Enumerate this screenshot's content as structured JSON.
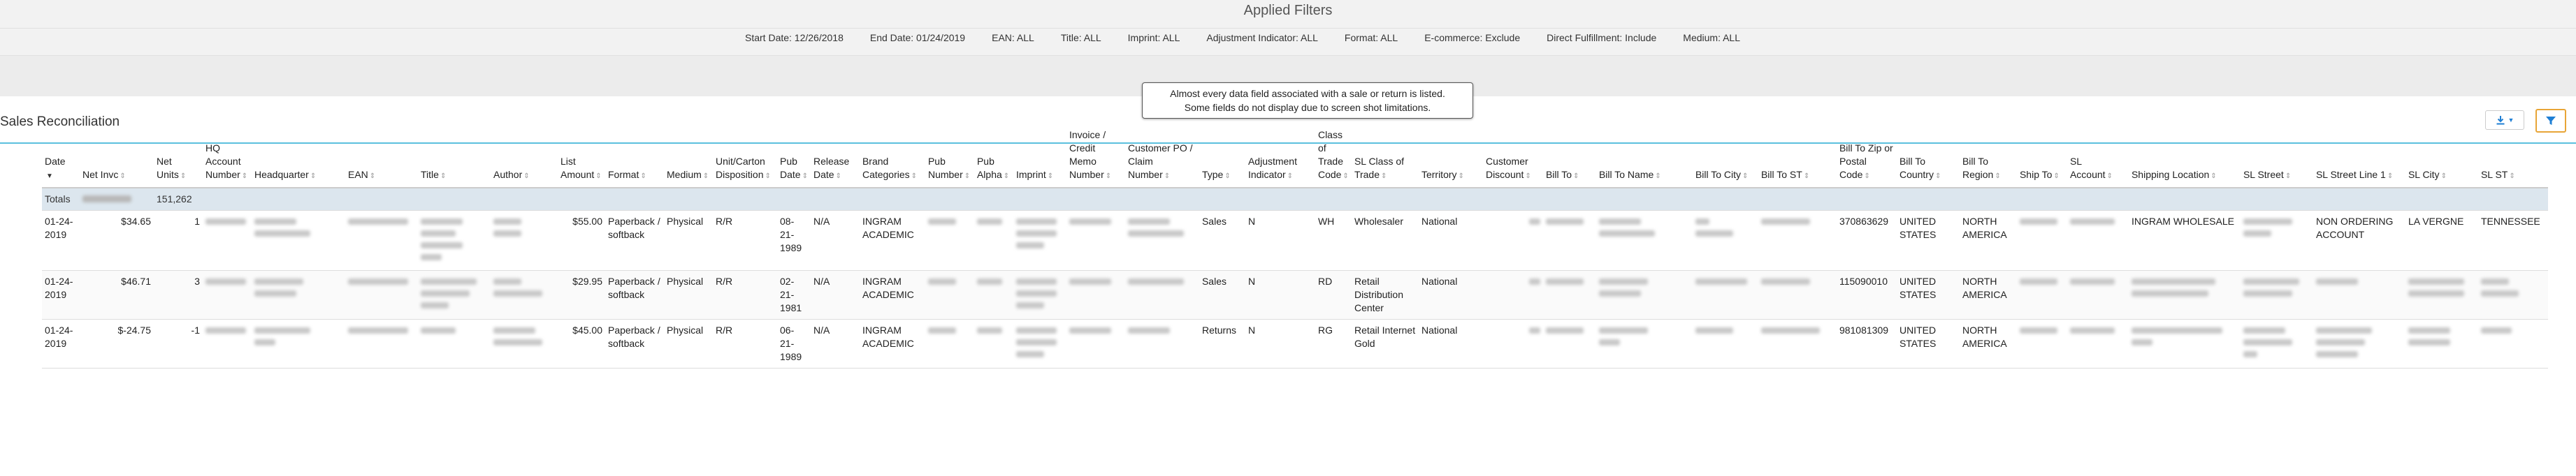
{
  "applied_filters": {
    "title": "Applied Filters",
    "items": [
      "Start Date: 12/26/2018",
      "End Date: 01/24/2019",
      "EAN: ALL",
      "Title: ALL",
      "Imprint: ALL",
      "Adjustment Indicator: ALL",
      "Format: ALL",
      "E-commerce: Exclude",
      "Direct Fulfillment: Include",
      "Medium: ALL"
    ]
  },
  "section": {
    "title": "Sales Reconciliation"
  },
  "tooltip": {
    "line1": "Almost every data field associated with a sale or return is listed.",
    "line2": "Some fields do not display due to screen shot limitations."
  },
  "toolbar": {
    "download_icon": "download-icon",
    "filter_icon": "filter-icon"
  },
  "colors": {
    "accent": "#5bc0de",
    "filter_border": "#e8a537",
    "icon_blue": "#1f7fd4",
    "totals_bg": "#dce6ee"
  },
  "table": {
    "columns": [
      "Date",
      "Net Invc",
      "Net Units",
      "HQ Account Number",
      "Headquarter",
      "EAN",
      "Title",
      "Author",
      "List Amount",
      "Format",
      "Medium",
      "Unit/Carton Disposition",
      "Pub Date",
      "Release Date",
      "Brand Categories",
      "Pub Number",
      "Pub Alpha",
      "Imprint",
      "Invoice / Credit Memo Number",
      "Customer PO / Claim Number",
      "Type",
      "Adjustment Indicator",
      "Class of Trade Code",
      "SL Class of Trade",
      "Territory",
      "Customer Discount",
      "Bill To",
      "Bill To Name",
      "Bill To City",
      "Bill To ST",
      "Bill To Zip or Postal Code",
      "Bill To Country",
      "Bill To Region",
      "Ship To",
      "SL Account",
      "Shipping Location",
      "SL Street",
      "SL Street Line 1",
      "SL City",
      "SL ST"
    ],
    "totals": {
      "label": "Totals",
      "net_units": "151,262"
    },
    "rows": [
      {
        "date": "01-24-2019",
        "net_invc": "$34.65",
        "net_units": "1",
        "list_amount": "$55.00",
        "format": "Paperback / softback",
        "medium": "Physical",
        "disposition": "R/R",
        "pub_date": "08-21-1989",
        "release_date": "N/A",
        "brand": "INGRAM ACADEMIC",
        "type": "Sales",
        "adjustment": "N",
        "class_code": "WH",
        "sl_class": "Wholesaler",
        "territory": "National",
        "zip": "370863629",
        "country": "UNITED STATES",
        "region": "NORTH AMERICA",
        "shipping_location": "INGRAM WHOLESALE",
        "sl_street_line1": "NON ORDERING ACCOUNT",
        "sl_city": "LA VERGNE",
        "sl_st": "TENNESSEE"
      },
      {
        "date": "01-24-2019",
        "net_invc": "$46.71",
        "net_units": "3",
        "list_amount": "$29.95",
        "format": "Paperback / softback",
        "medium": "Physical",
        "disposition": "R/R",
        "pub_date": "02-21-1981",
        "release_date": "N/A",
        "brand": "INGRAM ACADEMIC",
        "type": "Sales",
        "adjustment": "N",
        "class_code": "RD",
        "sl_class": "Retail Distribution Center",
        "territory": "National",
        "zip": "115090010",
        "country": "UNITED STATES",
        "region": "NORTH AMERICA",
        "shipping_location": "",
        "sl_street_line1": "",
        "sl_city": "",
        "sl_st": ""
      },
      {
        "date": "01-24-2019",
        "net_invc": "$-24.75",
        "net_units": "-1",
        "list_amount": "$45.00",
        "format": "Paperback / softback",
        "medium": "Physical",
        "disposition": "R/R",
        "pub_date": "06-21-1989",
        "release_date": "N/A",
        "brand": "INGRAM ACADEMIC",
        "type": "Returns",
        "adjustment": "N",
        "class_code": "RG",
        "sl_class": "Retail Internet Gold",
        "territory": "National",
        "zip": "981081309",
        "country": "UNITED STATES",
        "region": "NORTH AMERICA",
        "shipping_location": "",
        "sl_street_line1": "",
        "sl_city": "",
        "sl_st": ""
      }
    ]
  }
}
